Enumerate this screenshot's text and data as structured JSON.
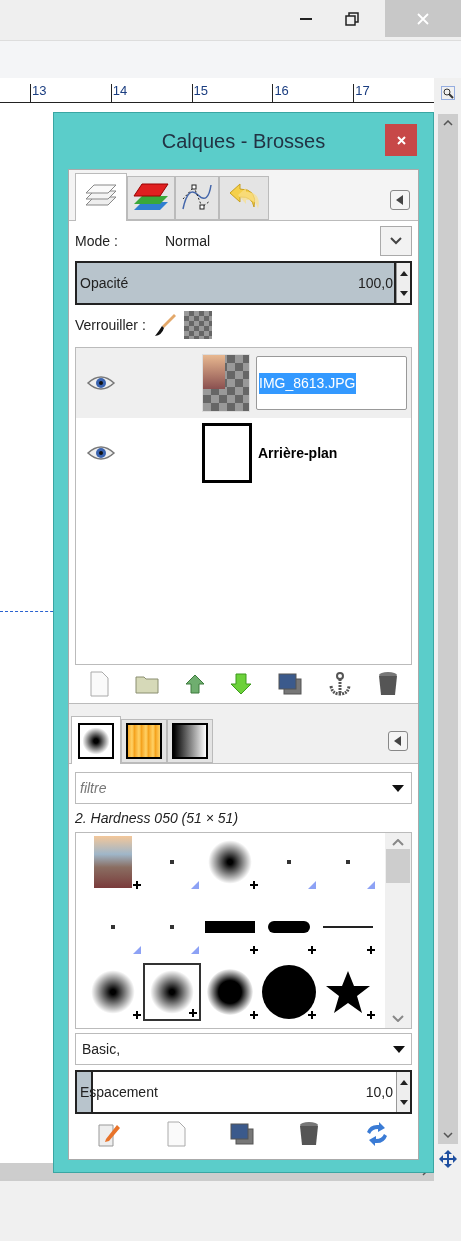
{
  "ruler": {
    "labels": [
      "13",
      "14",
      "15",
      "16",
      "17"
    ]
  },
  "dialog": {
    "title": "Calques - Brosses",
    "top_tabs": [
      {
        "kind": "layers",
        "selected": true
      },
      {
        "kind": "channels",
        "selected": false
      },
      {
        "kind": "paths",
        "selected": false
      },
      {
        "kind": "undo",
        "selected": false
      }
    ],
    "mode": {
      "label": "Mode :",
      "value": "Normal"
    },
    "opacity": {
      "label": "Opacité",
      "value": "100,0",
      "level": 1
    },
    "lock": {
      "label": "Verrouiller :"
    },
    "layers": [
      {
        "name": "IMG_8613.JPG",
        "kind": "photo",
        "selected": true,
        "visible": true,
        "editing": true
      },
      {
        "name": "Arrière-plan",
        "kind": "blank",
        "selected": false,
        "visible": true,
        "editing": false
      }
    ],
    "bottom_tabs": [
      {
        "kind": "brushes",
        "selected": true
      },
      {
        "kind": "patterns",
        "selected": false
      },
      {
        "kind": "gradients",
        "selected": false
      }
    ],
    "filter": {
      "placeholder": "filtre"
    },
    "brush_name": "2. Hardness 050 (51 × 51)",
    "brushes": [
      {
        "kind": "photo",
        "editable": true,
        "selected": false
      },
      {
        "kind": "dot",
        "editable": false,
        "selected": false
      },
      {
        "kind": "soft",
        "editable": true,
        "selected": false
      },
      {
        "kind": "dot",
        "editable": false,
        "selected": false
      },
      {
        "kind": "dot",
        "editable": false,
        "selected": false
      },
      {
        "kind": "dot",
        "editable": false,
        "selected": false
      },
      {
        "kind": "dot",
        "editable": false,
        "selected": false
      },
      {
        "kind": "rect",
        "editable": true,
        "selected": false
      },
      {
        "kind": "ellipse",
        "editable": true,
        "selected": false
      },
      {
        "kind": "line",
        "editable": true,
        "selected": false
      },
      {
        "kind": "soft",
        "editable": true,
        "selected": false
      },
      {
        "kind": "soft",
        "editable": true,
        "selected": true
      },
      {
        "kind": "softlarge",
        "editable": true,
        "selected": false
      },
      {
        "kind": "circle",
        "editable": true,
        "selected": false
      },
      {
        "kind": "star",
        "editable": true,
        "selected": false
      }
    ],
    "tags": {
      "value": "Basic,"
    },
    "spacing": {
      "label": "Espacement",
      "value": "10,0",
      "level": 0.05
    }
  }
}
